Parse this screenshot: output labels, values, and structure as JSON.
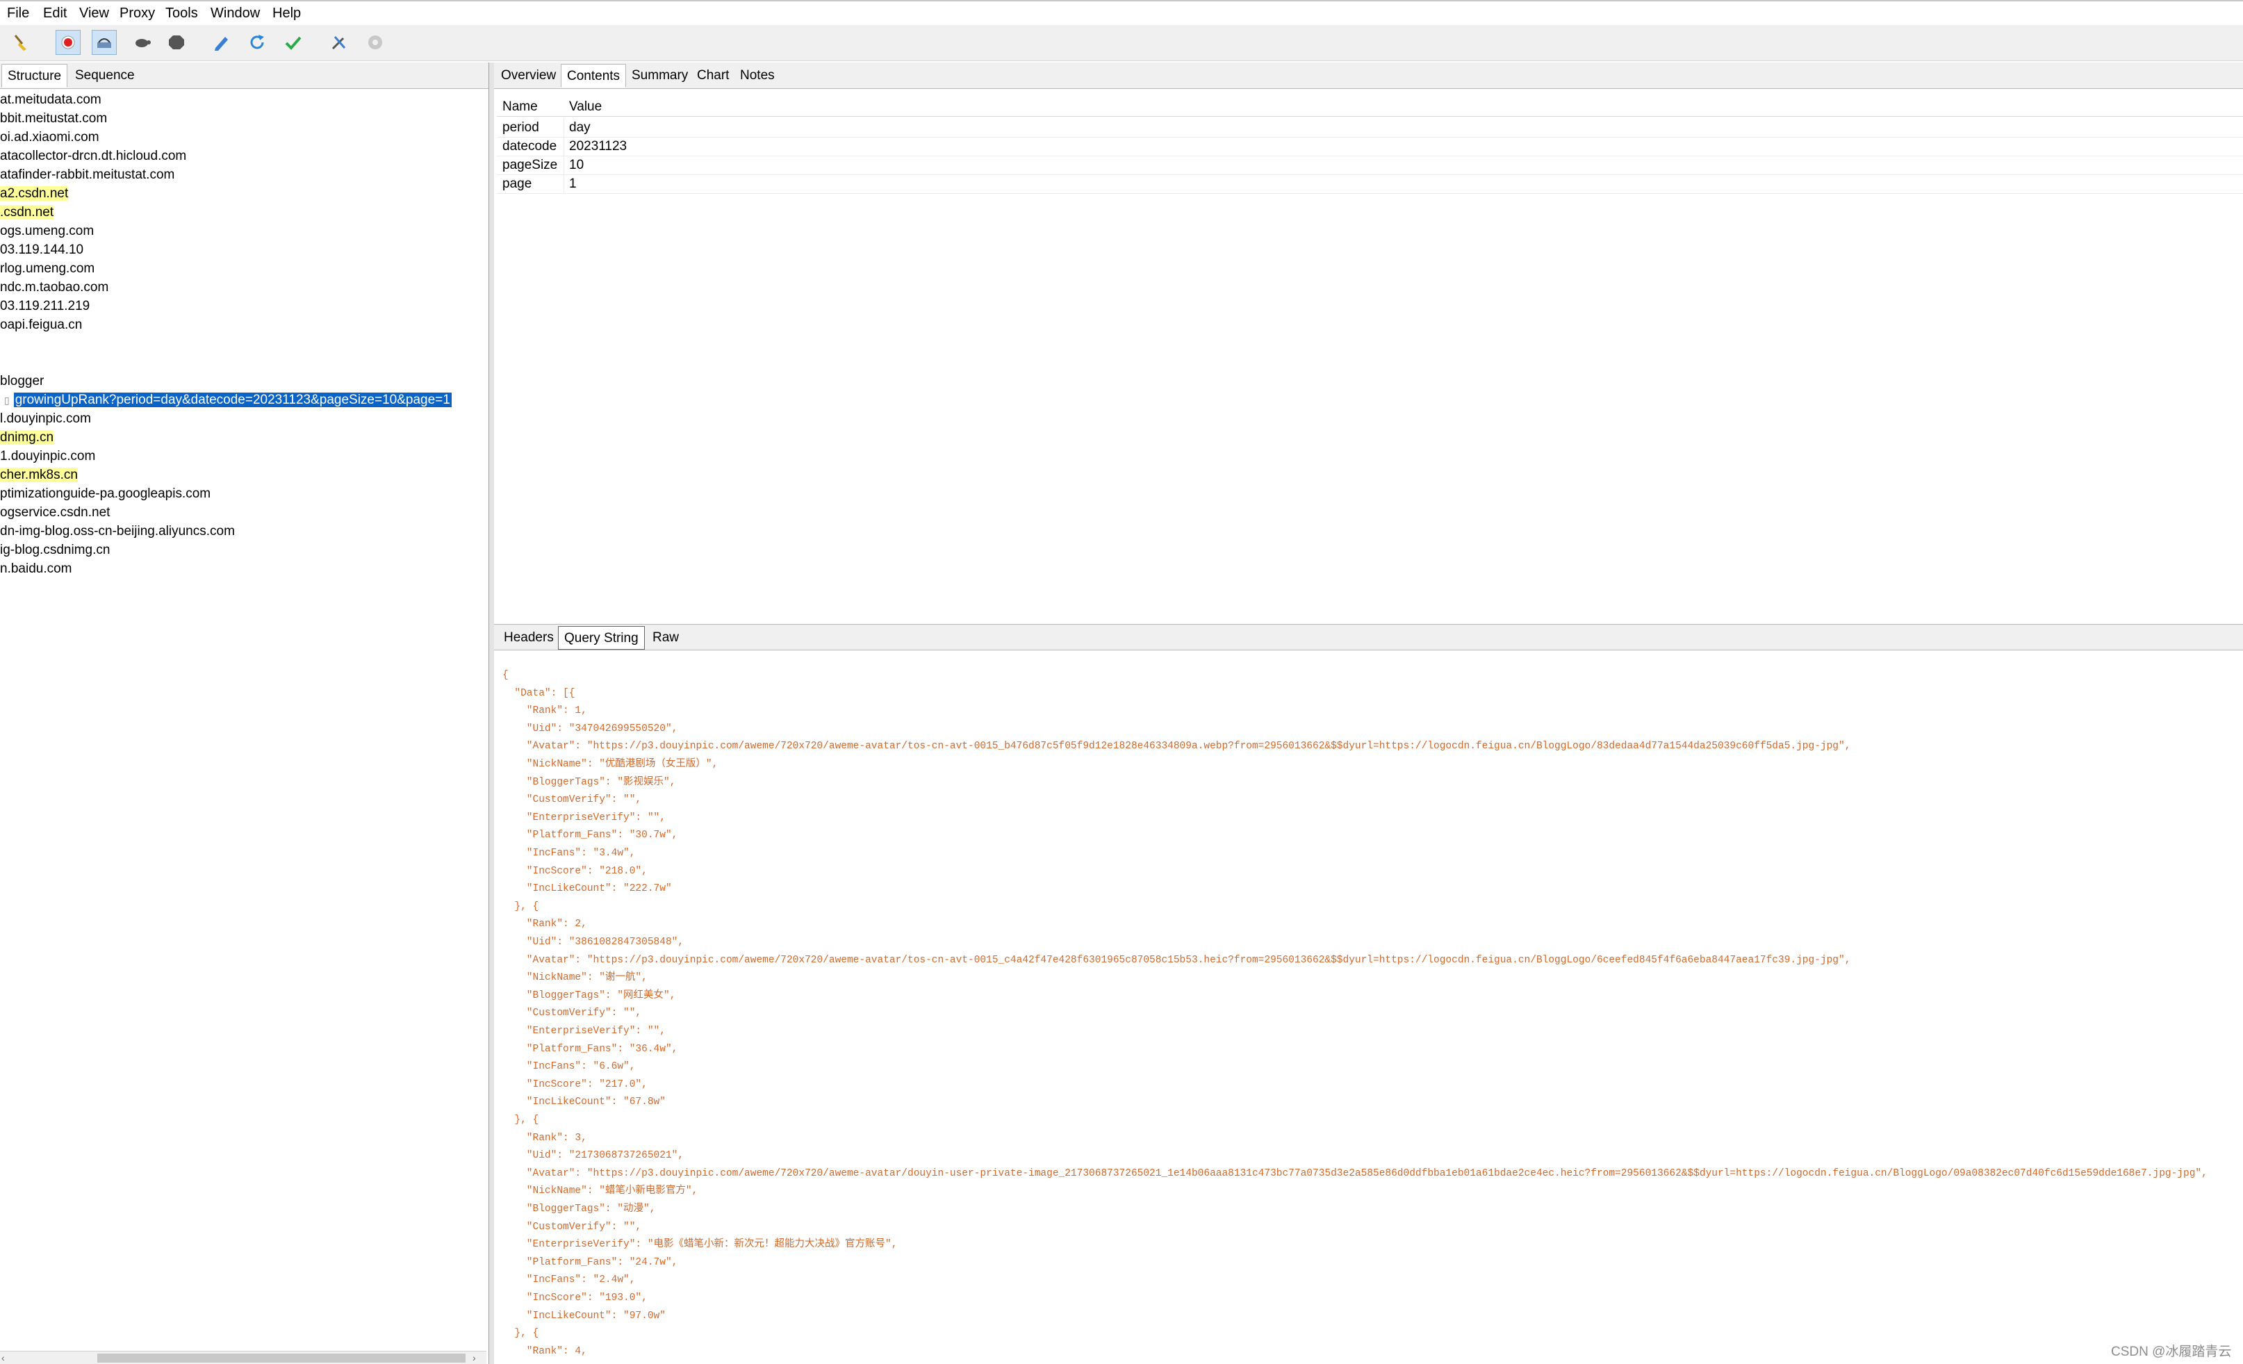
{
  "menu": [
    "File",
    "Edit",
    "View",
    "Proxy",
    "Tools",
    "Window",
    "Help"
  ],
  "toolbar_icons": [
    "broom-icon",
    "record-icon",
    "throttle-icon",
    "turtle-icon",
    "stop-icon",
    "pen-icon",
    "refresh-icon",
    "check-icon",
    "tools-icon",
    "settings-icon"
  ],
  "left": {
    "tabs": [
      "Structure",
      "Sequence"
    ],
    "active_tab": "Structure",
    "rows": [
      {
        "text": "at.meitudata.com",
        "hl": false
      },
      {
        "text": "bbit.meitustat.com",
        "hl": false
      },
      {
        "text": "oi.ad.xiaomi.com",
        "hl": false
      },
      {
        "text": "atacollector-drcn.dt.hicloud.com",
        "hl": false
      },
      {
        "text": "atafinder-rabbit.meitustat.com",
        "hl": false
      },
      {
        "text": "a2.csdn.net",
        "hl": true
      },
      {
        "text": ".csdn.net",
        "hl": true
      },
      {
        "text": "ogs.umeng.com",
        "hl": false
      },
      {
        "text": "03.119.144.10",
        "hl": false
      },
      {
        "text": "rlog.umeng.com",
        "hl": false
      },
      {
        "text": "ndc.m.taobao.com",
        "hl": false
      },
      {
        "text": "03.119.211.219",
        "hl": false
      },
      {
        "text": "oapi.feigua.cn",
        "hl": false
      },
      {
        "text": "",
        "hl": false
      },
      {
        "text": "",
        "hl": false
      },
      {
        "text": " blogger",
        "hl": false
      },
      {
        "text": "growingUpRank?period=day&datecode=20231123&pageSize=10&page=1",
        "hl": false,
        "selected": true
      },
      {
        "text": "l.douyinpic.com",
        "hl": false
      },
      {
        "text": "dnimg.cn",
        "hl": true
      },
      {
        "text": " 1.douyinpic.com",
        "hl": false
      },
      {
        "text": "cher.mk8s.cn",
        "hl": true
      },
      {
        "text": "ptimizationguide-pa.googleapis.com",
        "hl": false
      },
      {
        "text": "ogservice.csdn.net",
        "hl": false
      },
      {
        "text": "dn-img-blog.oss-cn-beijing.aliyuncs.com",
        "hl": false
      },
      {
        "text": "ig-blog.csdnimg.cn",
        "hl": false
      },
      {
        "text": "n.baidu.com",
        "hl": false
      }
    ]
  },
  "right": {
    "top_tabs": [
      "Overview",
      "Contents",
      "Summary",
      "Chart",
      "Notes"
    ],
    "active_top_tab": "Contents",
    "grid": {
      "headers": [
        "Name",
        "Value"
      ],
      "rows": [
        {
          "name": "period",
          "value": "day"
        },
        {
          "name": "datecode",
          "value": "20231123"
        },
        {
          "name": "pageSize",
          "value": "10"
        },
        {
          "name": "page",
          "value": "1"
        }
      ]
    },
    "bottom_tabs": [
      "Headers",
      "Query String",
      "Raw"
    ],
    "active_bottom_tab": "Query String",
    "json_lines": [
      "{",
      "  \"Data\": [{",
      "    \"Rank\": 1,",
      "    \"Uid\": \"347042699550520\",",
      "    \"Avatar\": \"https://p3.douyinpic.com/aweme/720x720/aweme-avatar/tos-cn-avt-0015_b476d87c5f05f9d12e1828e46334809a.webp?from=2956013662&$$dyurl=https://logocdn.feigua.cn/BloggLogo/83dedaa4d77a1544da25039c60ff5da5.jpg-jpg\",",
      "    \"NickName\": \"优酷港剧场（女王版）\",",
      "    \"BloggerTags\": \"影视娱乐\",",
      "    \"CustomVerify\": \"\",",
      "    \"EnterpriseVerify\": \"\",",
      "    \"Platform_Fans\": \"30.7w\",",
      "    \"IncFans\": \"3.4w\",",
      "    \"IncScore\": \"218.0\",",
      "    \"IncLikeCount\": \"222.7w\"",
      "  }, {",
      "    \"Rank\": 2,",
      "    \"Uid\": \"3861082847305848\",",
      "    \"Avatar\": \"https://p3.douyinpic.com/aweme/720x720/aweme-avatar/tos-cn-avt-0015_c4a42f47e428f6301965c87058c15b53.heic?from=2956013662&$$dyurl=https://logocdn.feigua.cn/BloggLogo/6ceefed845f4f6a6eba8447aea17fc39.jpg-jpg\",",
      "    \"NickName\": \"谢一航\",",
      "    \"BloggerTags\": \"网红美女\",",
      "    \"CustomVerify\": \"\",",
      "    \"EnterpriseVerify\": \"\",",
      "    \"Platform_Fans\": \"36.4w\",",
      "    \"IncFans\": \"6.6w\",",
      "    \"IncScore\": \"217.0\",",
      "    \"IncLikeCount\": \"67.8w\"",
      "  }, {",
      "    \"Rank\": 3,",
      "    \"Uid\": \"2173068737265021\",",
      "    \"Avatar\": \"https://p3.douyinpic.com/aweme/720x720/aweme-avatar/douyin-user-private-image_2173068737265021_1e14b06aaa8131c473bc77a0735d3e2a585e86d0ddfbba1eb01a61bdae2ce4ec.heic?from=2956013662&$$dyurl=https://logocdn.feigua.cn/BloggLogo/09a08382ec07d40fc6d15e59dde168e7.jpg-jpg\",",
      "    \"NickName\": \"蜡笔小新电影官方\",",
      "    \"BloggerTags\": \"动漫\",",
      "    \"CustomVerify\": \"\",",
      "    \"EnterpriseVerify\": \"电影《蜡笔小新：新次元！超能力大决战》官方账号\",",
      "    \"Platform_Fans\": \"24.7w\",",
      "    \"IncFans\": \"2.4w\",",
      "    \"IncScore\": \"193.0\",",
      "    \"IncLikeCount\": \"97.0w\"",
      "  }, {",
      "    \"Rank\": 4,"
    ]
  },
  "watermark": "CSDN @冰履踏青云"
}
